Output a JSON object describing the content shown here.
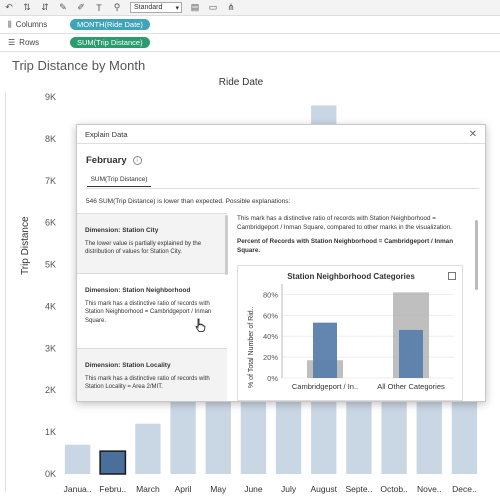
{
  "toolbar": {
    "view_select": "Standard"
  },
  "shelves": {
    "columns_label": "Columns",
    "columns_pill": "MONTH(Ride Date)",
    "rows_label": "Rows",
    "rows_pill": "SUM(Trip Distance)"
  },
  "sheet": {
    "title": "Trip Distance by Month"
  },
  "chart_data": {
    "type": "bar",
    "title": "Trip Distance by Month",
    "xlabel": "Ride Date",
    "ylabel": "Trip Distance",
    "categories": [
      "Janua..",
      "Febru..",
      "March",
      "April",
      "May",
      "June",
      "July",
      "August",
      "Septe..",
      "Octob..",
      "Nove..",
      "Dece.."
    ],
    "values": [
      700,
      546,
      1200,
      2400,
      2600,
      3200,
      3700,
      8800,
      6800,
      5200,
      4800,
      3600
    ],
    "yticks": [
      "0K",
      "1K",
      "2K",
      "3K",
      "4K",
      "5K",
      "6K",
      "7K",
      "8K",
      "9K"
    ],
    "ylim": [
      0,
      9000
    ],
    "highlighted_category": "Febru..",
    "colors": {
      "bar": "#c9d6e3",
      "highlight": "#4a6f9b",
      "highlight_border": "#1a1a1a"
    }
  },
  "modal": {
    "header": "Explain Data",
    "close_glyph": "✕",
    "mark_title": "February",
    "info_glyph": "i",
    "measure_tab": "SUM(Trip Distance)",
    "summary": "546 SUM(Trip Distance) is lower than expected. Possible explanations:",
    "explanations": [
      {
        "title": "Dimension: Station City",
        "text": "The lower value is partially explained by the distribution of values for Station City."
      },
      {
        "title": "Dimension: Station Neighborhood",
        "text": "This mark has a distinctive ratio of records with Station Neighborhood = Cambridgeport / Inman Square."
      },
      {
        "title": "Dimension: Station Locality",
        "text": "This mark has a distinctive ratio of records with Station Locality = Area 2/MIT."
      }
    ],
    "detail_text": "This mark has a distinctive ratio of records with Station Neighborhood = Cambridgeport / Inman Square, compared to other marks in the visualization.",
    "detail_bold": "Percent of Records with Station Neighborhood = Cambridgeport / Inman Square."
  },
  "mini_chart": {
    "type": "bar",
    "title": "Station Neighborhood Categories",
    "ylabel": "% of Total Number of Rid..",
    "yticks": [
      "0%",
      "20%",
      "40%",
      "60%",
      "80%"
    ],
    "ylim": [
      0,
      90
    ],
    "categories": [
      "Cambridgeport / In..",
      "All Other Categories"
    ],
    "series": [
      {
        "values": [
          17,
          82
        ],
        "color": "#a9a9a9"
      },
      {
        "values": [
          53,
          46
        ],
        "color": "#5b80ad"
      }
    ]
  }
}
